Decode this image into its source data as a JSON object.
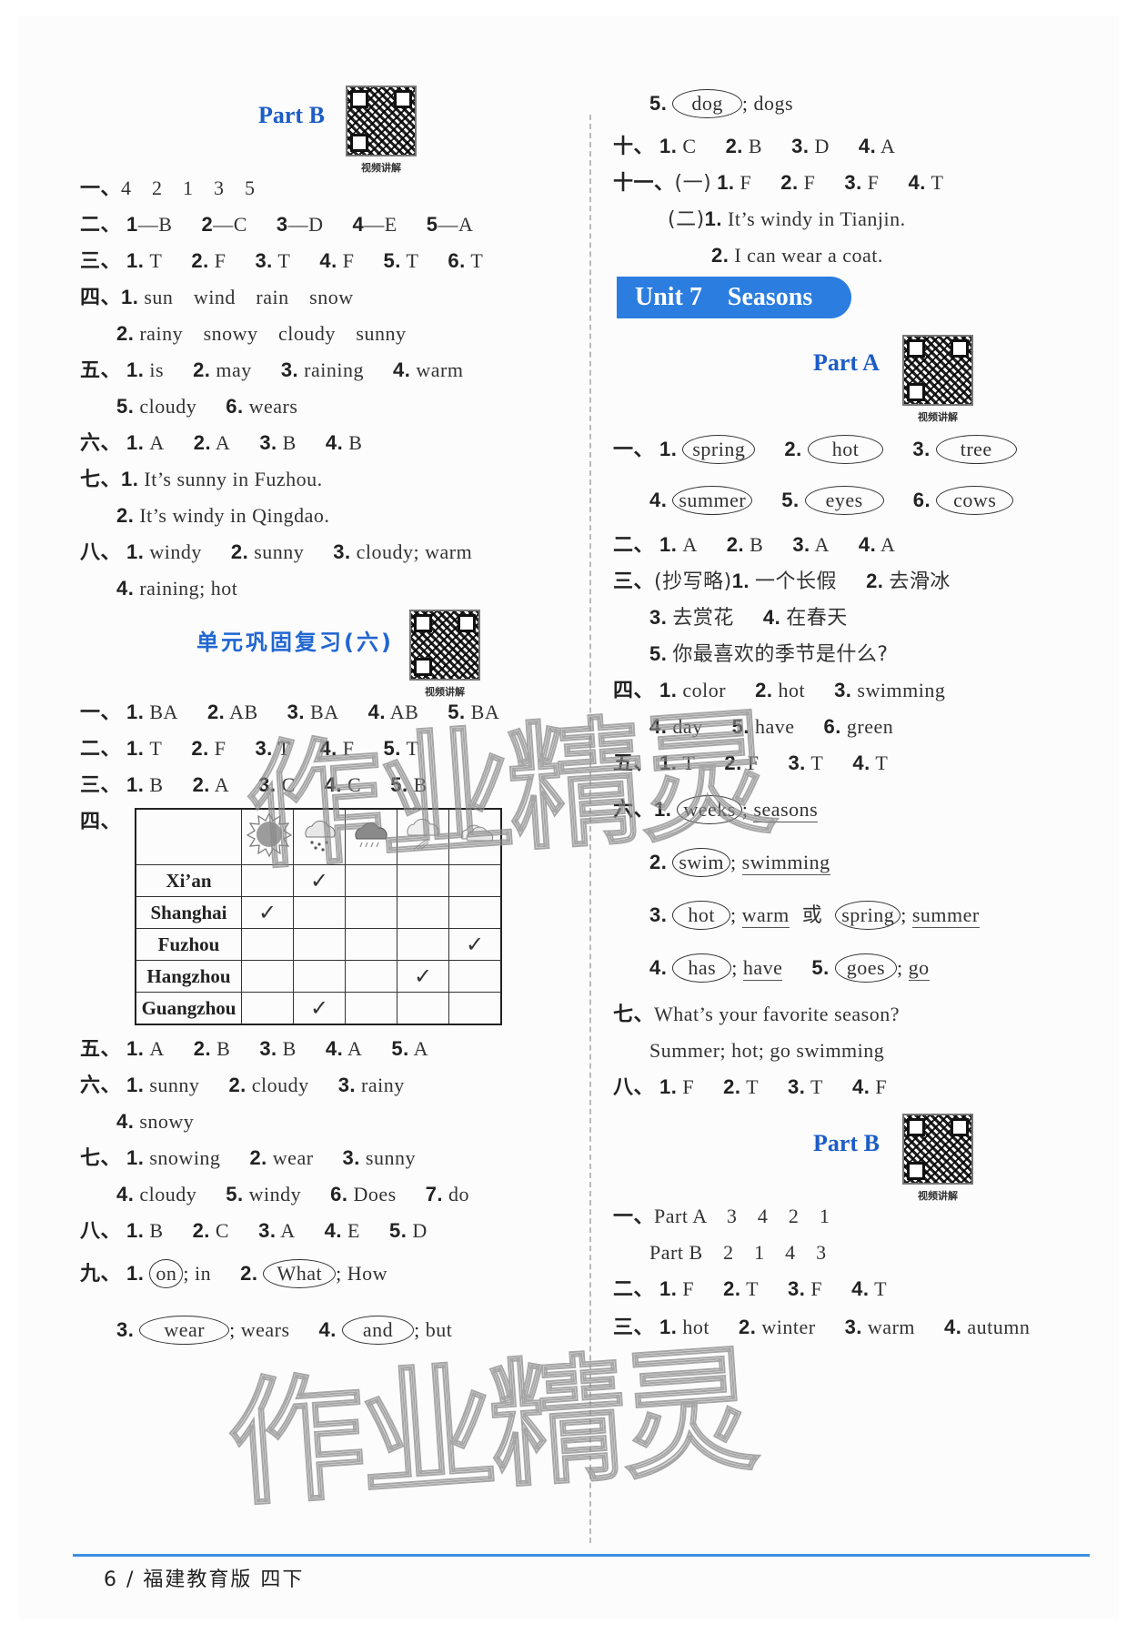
{
  "left": {
    "partB": {
      "title": "Part B",
      "qr_label": "视频讲解",
      "q1": {
        "label": "一、",
        "items": "4　2　1　3　5"
      },
      "q2": {
        "label": "二、",
        "items": [
          [
            "1",
            "—B"
          ],
          [
            "2",
            "—C"
          ],
          [
            "3",
            "—D"
          ],
          [
            "4",
            "—E"
          ],
          [
            "5",
            "—A"
          ]
        ]
      },
      "q3": {
        "label": "三、",
        "items": [
          [
            "1.",
            "T"
          ],
          [
            "2.",
            "F"
          ],
          [
            "3.",
            "T"
          ],
          [
            "4.",
            "F"
          ],
          [
            "5.",
            "T"
          ],
          [
            "6.",
            "T"
          ]
        ]
      },
      "q4": {
        "label": "四、",
        "row1": {
          "n": "1.",
          "text": "sun　wind　rain　snow"
        },
        "row2": {
          "n": "2.",
          "text": "rainy　snowy　cloudy　sunny"
        }
      },
      "q5": {
        "label": "五、",
        "row1": [
          [
            "1.",
            "is"
          ],
          [
            "2.",
            "may"
          ],
          [
            "3.",
            "raining"
          ],
          [
            "4.",
            "warm"
          ]
        ],
        "row2": [
          [
            "5.",
            "cloudy"
          ],
          [
            "6.",
            "wears"
          ]
        ]
      },
      "q6": {
        "label": "六、",
        "items": [
          [
            "1.",
            "A"
          ],
          [
            "2.",
            "A"
          ],
          [
            "3.",
            "B"
          ],
          [
            "4.",
            "B"
          ]
        ]
      },
      "q7": {
        "label": "七、",
        "row1": {
          "n": "1.",
          "text": "It’s sunny in Fuzhou."
        },
        "row2": {
          "n": "2.",
          "text": "It’s windy in Qingdao."
        }
      },
      "q8": {
        "label": "八、",
        "row1": [
          [
            "1.",
            "windy"
          ],
          [
            "2.",
            "sunny"
          ],
          [
            "3.",
            "cloudy; warm"
          ]
        ],
        "row2": [
          [
            "4.",
            "raining; hot"
          ]
        ]
      }
    },
    "review": {
      "title": "单元巩固复习(六)",
      "qr_label": "视频讲解",
      "q1": {
        "label": "一、",
        "items": [
          [
            "1.",
            "BA"
          ],
          [
            "2.",
            "AB"
          ],
          [
            "3.",
            "BA"
          ],
          [
            "4.",
            "AB"
          ],
          [
            "5.",
            "BA"
          ]
        ]
      },
      "q2": {
        "label": "二、",
        "items": [
          [
            "1.",
            "T"
          ],
          [
            "2.",
            "F"
          ],
          [
            "3.",
            "T"
          ],
          [
            "4.",
            "F"
          ],
          [
            "5.",
            "T"
          ]
        ]
      },
      "q3": {
        "label": "三、",
        "items": [
          [
            "1.",
            "B"
          ],
          [
            "2.",
            "A"
          ],
          [
            "3.",
            "C"
          ],
          [
            "4.",
            "C"
          ],
          [
            "5.",
            "B"
          ]
        ]
      },
      "q4": {
        "label": "四、",
        "weather_icons": [
          "sunny-icon",
          "snowy-icon",
          "rainy-icon",
          "windy-icon",
          "cloudy-icon"
        ],
        "rows": [
          {
            "city": "Xi’an",
            "checks": [
              false,
              true,
              false,
              false,
              false
            ]
          },
          {
            "city": "Shanghai",
            "checks": [
              true,
              false,
              false,
              false,
              false
            ]
          },
          {
            "city": "Fuzhou",
            "checks": [
              false,
              false,
              false,
              false,
              true
            ]
          },
          {
            "city": "Hangzhou",
            "checks": [
              false,
              false,
              false,
              true,
              false
            ]
          },
          {
            "city": "Guangzhou",
            "checks": [
              false,
              true,
              false,
              false,
              false
            ]
          }
        ],
        "check_mark": "✓"
      },
      "q5": {
        "label": "五、",
        "items": [
          [
            "1.",
            "A"
          ],
          [
            "2.",
            "B"
          ],
          [
            "3.",
            "B"
          ],
          [
            "4.",
            "A"
          ],
          [
            "5.",
            "A"
          ]
        ]
      },
      "q6": {
        "label": "六、",
        "row1": [
          [
            "1.",
            "sunny"
          ],
          [
            "2.",
            "cloudy"
          ],
          [
            "3.",
            "rainy"
          ]
        ],
        "row2": [
          [
            "4.",
            "snowy"
          ]
        ]
      },
      "q7": {
        "label": "七、",
        "row1": [
          [
            "1.",
            "snowing"
          ],
          [
            "2.",
            "wear"
          ],
          [
            "3.",
            "sunny"
          ]
        ],
        "row2": [
          [
            "4.",
            "cloudy"
          ],
          [
            "5.",
            "windy"
          ],
          [
            "6.",
            "Does"
          ],
          [
            "7.",
            "do"
          ]
        ]
      },
      "q8": {
        "label": "八、",
        "items": [
          [
            "1.",
            "B"
          ],
          [
            "2.",
            "C"
          ],
          [
            "3.",
            "A"
          ],
          [
            "4.",
            "E"
          ],
          [
            "5.",
            "D"
          ]
        ]
      },
      "q9": {
        "label": "九、",
        "row1": [
          {
            "n": "1.",
            "circled": "on",
            "plain": "in"
          },
          {
            "n": "2.",
            "circled": "What",
            "plain": "How"
          }
        ],
        "row2": [
          {
            "n": "3.",
            "circled": "wear",
            "plain": "wears"
          },
          {
            "n": "4.",
            "circled": "and",
            "plain": "but"
          }
        ]
      }
    }
  },
  "right": {
    "review_cont": {
      "q9_5": {
        "n": "5.",
        "circled": "dog",
        "plain": "dogs"
      },
      "q10": {
        "label": "十、",
        "items": [
          [
            "1.",
            "C"
          ],
          [
            "2.",
            "B"
          ],
          [
            "3.",
            "D"
          ],
          [
            "4.",
            "A"
          ]
        ]
      },
      "q11": {
        "label": "十一、",
        "sub1": "(一)",
        "items": [
          [
            "1.",
            "F"
          ],
          [
            "2.",
            "F"
          ],
          [
            "3.",
            "F"
          ],
          [
            "4.",
            "T"
          ]
        ],
        "sub2": "(二)",
        "row2": {
          "n": "1.",
          "text": "It’s windy in Tianjin."
        },
        "row3": {
          "n": "2.",
          "text": "I can wear a coat."
        }
      }
    },
    "unit": {
      "title": "Unit 7　Seasons"
    },
    "partA": {
      "title": "Part A",
      "qr_label": "视频讲解",
      "q1": {
        "label": "一、",
        "row1": [
          [
            "1.",
            "spring"
          ],
          [
            "2.",
            "hot"
          ],
          [
            "3.",
            "tree"
          ]
        ],
        "row2": [
          [
            "4.",
            "summer"
          ],
          [
            "5.",
            "eyes"
          ],
          [
            "6.",
            "cows"
          ]
        ]
      },
      "q2": {
        "label": "二、",
        "items": [
          [
            "1.",
            "A"
          ],
          [
            "2.",
            "B"
          ],
          [
            "3.",
            "A"
          ],
          [
            "4.",
            "A"
          ]
        ]
      },
      "q3": {
        "label": "三、",
        "note": "(抄写略)",
        "row1": [
          [
            "1.",
            "一个长假"
          ],
          [
            "2.",
            "去滑冰"
          ]
        ],
        "row2": [
          [
            "3.",
            "去赏花"
          ],
          [
            "4.",
            "在春天"
          ]
        ],
        "row3": [
          [
            "5.",
            "你最喜欢的季节是什么?"
          ]
        ]
      },
      "q4": {
        "label": "四、",
        "row1": [
          [
            "1.",
            "color"
          ],
          [
            "2.",
            "hot"
          ],
          [
            "3.",
            "swimming"
          ]
        ],
        "row2": [
          [
            "4.",
            "day"
          ],
          [
            "5.",
            "have"
          ],
          [
            "6.",
            "green"
          ]
        ]
      },
      "q5": {
        "label": "五、",
        "items": [
          [
            "1.",
            "T"
          ],
          [
            "2.",
            "F"
          ],
          [
            "3.",
            "T"
          ],
          [
            "4.",
            "T"
          ]
        ]
      },
      "q6": {
        "label": "六、",
        "r1": {
          "n": "1.",
          "circled": "weeks",
          "under": "seasons"
        },
        "r2": {
          "n": "2.",
          "circled": "swim",
          "under": "swimming"
        },
        "r3": {
          "n": "3.",
          "circled": "hot",
          "under": "warm",
          "or": "或",
          "circled2": "spring",
          "under2": "summer"
        },
        "r4": {
          "n": "4.",
          "circled": "has",
          "under": "have",
          "n2": "5.",
          "circled2": "goes",
          "under2": "go"
        }
      },
      "q7": {
        "label": "七、",
        "row1": "What’s your favorite season?",
        "row2": "Summer; hot; go swimming"
      },
      "q8": {
        "label": "八、",
        "items": [
          [
            "1.",
            "F"
          ],
          [
            "2.",
            "T"
          ],
          [
            "3.",
            "T"
          ],
          [
            "4.",
            "F"
          ]
        ]
      }
    },
    "partB": {
      "title": "Part B",
      "qr_label": "视频讲解",
      "q1": {
        "label": "一、",
        "row1": "Part A　3　4　2　1",
        "row2": "Part B　2　1　4　3"
      },
      "q2": {
        "label": "二、",
        "items": [
          [
            "1.",
            "F"
          ],
          [
            "2.",
            "T"
          ],
          [
            "3.",
            "F"
          ],
          [
            "4.",
            "T"
          ]
        ]
      },
      "q3": {
        "label": "三、",
        "items": [
          [
            "1.",
            "hot"
          ],
          [
            "2.",
            "winter"
          ],
          [
            "3.",
            "warm"
          ],
          [
            "4.",
            "autumn"
          ]
        ]
      }
    }
  },
  "footer": {
    "text": "6 / 福建教育版 四下"
  },
  "watermark": {
    "text": "作业精灵"
  }
}
